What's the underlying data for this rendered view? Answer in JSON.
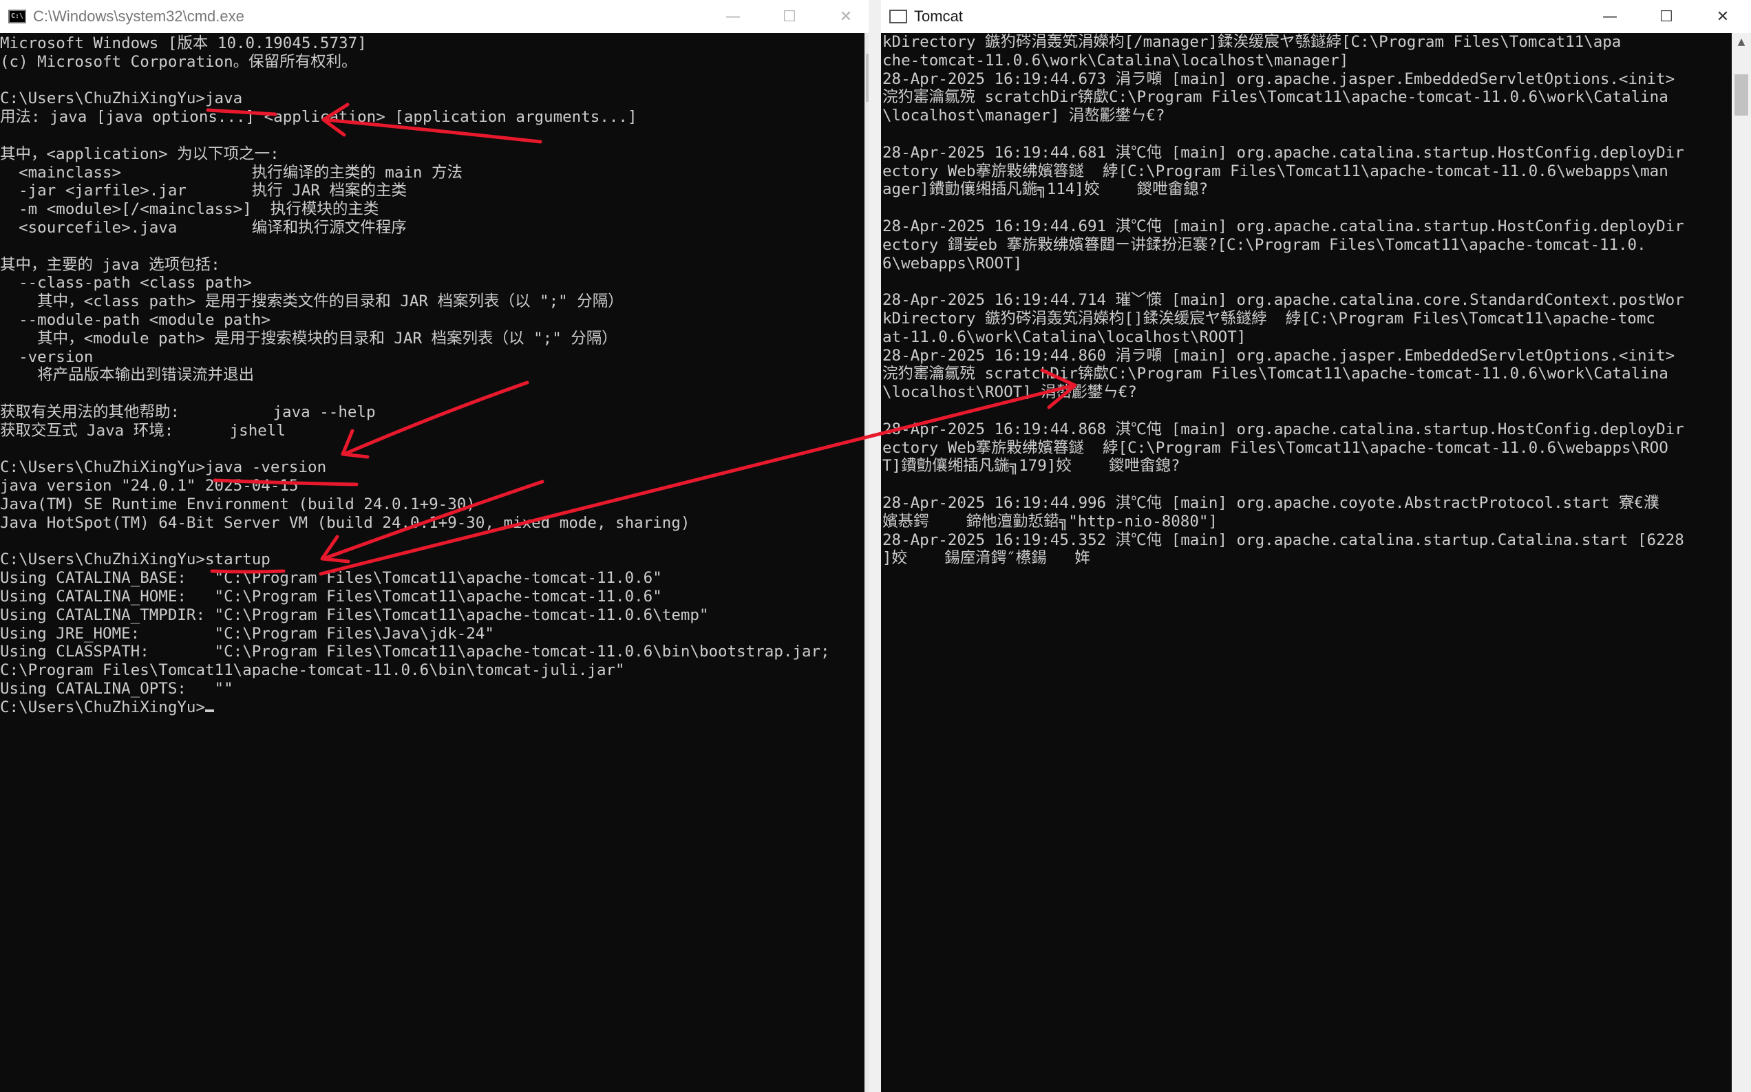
{
  "cmd_window": {
    "title": "C:\\Windows\\system32\\cmd.exe",
    "icon": "C:\\",
    "lines": [
      "Microsoft Windows [版本 10.0.19045.5737]",
      "(c) Microsoft Corporation。保留所有权利。",
      "",
      "C:\\Users\\ChuZhiXingYu>java",
      "用法: java [java options...] <application> [application arguments...]",
      "",
      "其中，<application> 为以下项之一:",
      "  <mainclass>              执行编译的主类的 main 方法",
      "  -jar <jarfile>.jar       执行 JAR 档案的主类",
      "  -m <module>[/<mainclass>]  执行模块的主类",
      "  <sourcefile>.java        编译和执行源文件程序",
      "",
      "其中，主要的 java 选项包括:",
      "  --class-path <class path>",
      "    其中，<class path> 是用于搜索类文件的目录和 JAR 档案列表（以 \";\" 分隔）",
      "  --module-path <module path>",
      "    其中，<module path> 是用于搜索模块的目录和 JAR 档案列表（以 \";\" 分隔）",
      "  -version",
      "    将产品版本输出到错误流并退出",
      "",
      "获取有关用法的其他帮助:          java --help",
      "获取交互式 Java 环境:      jshell",
      "",
      "C:\\Users\\ChuZhiXingYu>java -version",
      "java version \"24.0.1\" 2025-04-15",
      "Java(TM) SE Runtime Environment (build 24.0.1+9-30)",
      "Java HotSpot(TM) 64-Bit Server VM (build 24.0.1+9-30, mixed mode, sharing)",
      "",
      "C:\\Users\\ChuZhiXingYu>startup",
      "Using CATALINA_BASE:   \"C:\\Program Files\\Tomcat11\\apache-tomcat-11.0.6\"",
      "Using CATALINA_HOME:   \"C:\\Program Files\\Tomcat11\\apache-tomcat-11.0.6\"",
      "Using CATALINA_TMPDIR: \"C:\\Program Files\\Tomcat11\\apache-tomcat-11.0.6\\temp\"",
      "Using JRE_HOME:        \"C:\\Program Files\\Java\\jdk-24\"",
      "Using CLASSPATH:       \"C:\\Program Files\\Tomcat11\\apache-tomcat-11.0.6\\bin\\bootstrap.jar;",
      "C:\\Program Files\\Tomcat11\\apache-tomcat-11.0.6\\bin\\tomcat-juli.jar\"",
      "Using CATALINA_OPTS:   \"\"",
      "C:\\Users\\ChuZhiXingYu>"
    ]
  },
  "tomcat_window": {
    "title": "Tomcat",
    "lines": [
      "kDirectory 鏃犳硶涓轰笂涓嬫枃[/manager]鍒涘缓宸ヤ綔鐩綍[C:\\Program Files\\Tomcat11\\apa",
      "che-tomcat-11.0.6\\work\\Catalina\\localhost\\manager]",
      "28-Apr-2025 16:19:44.673 涓ラ噸 [main] org.apache.jasper.EmbeddedServletOptions.<init>",
      "浣犳寚瀹氱殑 scratchDir锛歔C:\\Program Files\\Tomcat11\\apache-tomcat-11.0.6\\work\\Catalina",
      "\\localhost\\manager] 涓嶅彲鐢ㄣ€?",
      "",
      "28-Apr-2025 16:19:44.681 淇℃伅 [main] org.apache.catalina.startup.HostConfig.deployDir",
      "ectory Web搴旂敤绋嬪簭鐩  綍[C:\\Program Files\\Tomcat11\\apache-tomcat-11.0.6\\webapps\\man",
      "ager]鐨勯儴缃插凡鍦╗114]姣    鍐呭畬鎴?",
      "",
      "28-Apr-2025 16:19:44.691 淇℃伅 [main] org.apache.catalina.startup.HostConfig.deployDir",
      "ectory 鎶妛eb 搴旂敤绋嬪簭閮ㄧ讲鍒扮洰褰?[C:\\Program Files\\Tomcat11\\apache-tomcat-11.0.",
      "6\\webapps\\ROOT]",
      "",
      "28-Apr-2025 16:19:44.714 璀﹀憡 [main] org.apache.catalina.core.StandardContext.postWor",
      "kDirectory 鏃犳硶涓轰笂涓嬫枃[]鍒涘缓宸ヤ綔鐩綍  綍[C:\\Program Files\\Tomcat11\\apache-tomc",
      "at-11.0.6\\work\\Catalina\\localhost\\ROOT]",
      "28-Apr-2025 16:19:44.860 涓ラ噸 [main] org.apache.jasper.EmbeddedServletOptions.<init>",
      "浣犳寚瀹氱殑 scratchDir锛歔C:\\Program Files\\Tomcat11\\apache-tomcat-11.0.6\\work\\Catalina",
      "\\localhost\\ROOT] 涓嶅彲鐢ㄣ€?",
      "",
      "28-Apr-2025 16:19:44.868 淇℃伅 [main] org.apache.catalina.startup.HostConfig.deployDir",
      "ectory Web搴旂敤绋嬪簭鐩  綍[C:\\Program Files\\Tomcat11\\apache-tomcat-11.0.6\\webapps\\ROO",
      "T]鐨勯儴缃插凡鍦╗179]姣    鍐呭畬鎴?",
      "",
      "28-Apr-2025 16:19:44.996 淇℃伅 [main] org.apache.coyote.AbstractProtocol.start 寮€濮",
      "嬪惎鍔    鍗忚澶勭悊鍣╗\"http-nio-8080\"]",
      "28-Apr-2025 16:19:45.352 淇℃伅 [main] org.apache.catalina.startup.Catalina.start [6228",
      "]姣    鍚庢湇鍔″櫒鍚   姩"
    ]
  },
  "caption_buttons": {
    "minimize": "—",
    "maximize": "☐",
    "close": "✕"
  },
  "colors": {
    "console_bg": "#0c0c0c",
    "console_text": "#cccccc",
    "annotation_red": "#e8192c"
  },
  "icons": [
    "cmd-window-icon",
    "tomcat-window-icon",
    "minimize-icon",
    "maximize-icon",
    "close-icon"
  ]
}
